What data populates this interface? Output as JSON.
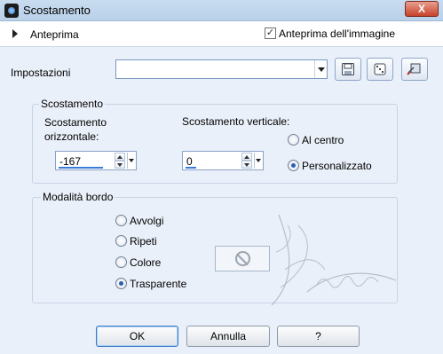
{
  "window": {
    "title": "Scostamento",
    "close_label": "X"
  },
  "preview": {
    "expand_label": "Anteprima",
    "image_preview_checked": true,
    "image_preview_label": "Anteprima dell'immagine"
  },
  "settings": {
    "label": "Impostazioni",
    "preset_value": "",
    "icons": [
      "save-icon",
      "randomize-dice-icon",
      "reset-icon"
    ]
  },
  "offset": {
    "group_title": "Scostamento",
    "horizontal_label_line1": "Scostamento",
    "horizontal_label_line2": "orizzontale:",
    "horizontal_value": "-167",
    "vertical_label": "Scostamento verticale:",
    "vertical_value": "0",
    "center_label": "Al centro",
    "custom_label": "Personalizzato",
    "selected": "custom"
  },
  "edge_mode": {
    "group_title": "Modalità bordo",
    "options": [
      "Avvolgi",
      "Ripeti",
      "Colore",
      "Trasparente"
    ],
    "selected": "Trasparente"
  },
  "buttons": {
    "ok": "OK",
    "cancel": "Annulla",
    "help": "?"
  },
  "colors": {
    "panel": "#eaf0f9",
    "accent": "#3b7ad8"
  }
}
